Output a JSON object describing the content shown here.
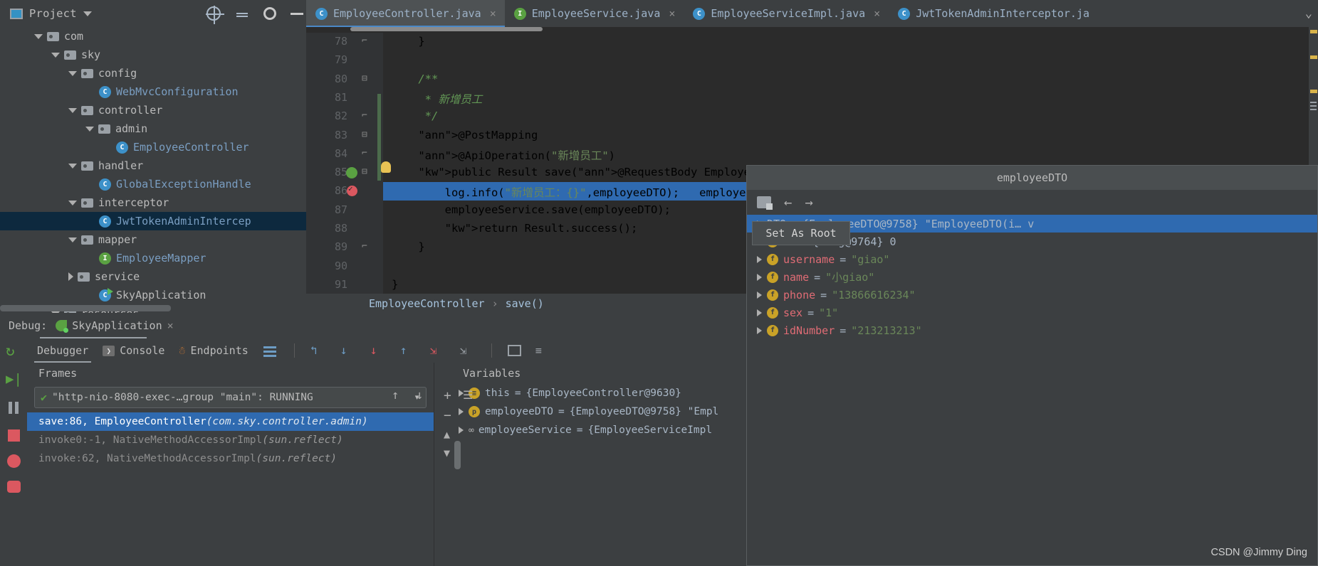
{
  "window": {
    "project_label": "Project",
    "icons": [
      "project-icon",
      "chevron-down-icon",
      "target-icon",
      "collapse-all-icon",
      "gear-icon",
      "minimize-icon"
    ]
  },
  "tabs": [
    {
      "label": "EmployeeController.java",
      "badge": "C",
      "badge_type": "class",
      "active": true,
      "close": "×"
    },
    {
      "label": "EmployeeService.java",
      "badge": "I",
      "badge_type": "interface",
      "active": false,
      "close": "×"
    },
    {
      "label": "EmployeeServiceImpl.java",
      "badge": "C",
      "badge_type": "class",
      "active": false,
      "close": "×"
    },
    {
      "label": "JwtTokenAdminInterceptor.ja",
      "badge": "C",
      "badge_type": "class",
      "active": false,
      "close": ""
    }
  ],
  "tabs_more_icon": "⌄",
  "tree": [
    {
      "label": "com",
      "indent": 2,
      "arrow": "down",
      "icon": "folder",
      "selected": false
    },
    {
      "label": "sky",
      "indent": 3,
      "arrow": "down",
      "icon": "folder",
      "selected": false
    },
    {
      "label": "config",
      "indent": 4,
      "arrow": "down",
      "icon": "folder",
      "selected": false
    },
    {
      "label": "WebMvcConfiguration",
      "indent": 5,
      "arrow": "none",
      "icon": "class",
      "selected": false
    },
    {
      "label": "controller",
      "indent": 4,
      "arrow": "down",
      "icon": "folder",
      "selected": false
    },
    {
      "label": "admin",
      "indent": 5,
      "arrow": "down",
      "icon": "folder",
      "selected": false
    },
    {
      "label": "EmployeeController",
      "indent": 6,
      "arrow": "none",
      "icon": "class",
      "selected": false
    },
    {
      "label": "handler",
      "indent": 4,
      "arrow": "down",
      "icon": "folder",
      "selected": false
    },
    {
      "label": "GlobalExceptionHandle",
      "indent": 5,
      "arrow": "none",
      "icon": "class",
      "selected": false
    },
    {
      "label": "interceptor",
      "indent": 4,
      "arrow": "down",
      "icon": "folder",
      "selected": false
    },
    {
      "label": "JwtTokenAdminIntercep",
      "indent": 5,
      "arrow": "none",
      "icon": "class",
      "selected": true
    },
    {
      "label": "mapper",
      "indent": 4,
      "arrow": "down",
      "icon": "folder",
      "selected": false
    },
    {
      "label": "EmployeeMapper",
      "indent": 5,
      "arrow": "none",
      "icon": "interface",
      "selected": false
    },
    {
      "label": "service",
      "indent": 4,
      "arrow": "right",
      "icon": "folder",
      "selected": false
    },
    {
      "label": "SkyApplication",
      "indent": 5,
      "arrow": "none",
      "icon": "spring-class",
      "selected": false
    },
    {
      "label": "resources",
      "indent": 3,
      "arrow": "down",
      "icon": "resources-folder",
      "selected": false
    }
  ],
  "editor": {
    "lines": [
      {
        "n": "78",
        "fold": "collapse",
        "text": "    }"
      },
      {
        "n": "79",
        "fold": "",
        "text": ""
      },
      {
        "n": "80",
        "fold": "expand",
        "text": "    /**"
      },
      {
        "n": "81",
        "fold": "",
        "text": "     * 新增员工"
      },
      {
        "n": "82",
        "fold": "collapse",
        "text": "     */"
      },
      {
        "n": "83",
        "fold": "expand",
        "text": "    @PostMapping"
      },
      {
        "n": "84",
        "fold": "collapse",
        "text": "    @ApiOperation(\"新增员工\")"
      },
      {
        "n": "85",
        "fold": "expand",
        "text": "    public Result save(@RequestBody EmployeeDTO emplo"
      },
      {
        "n": "86",
        "fold": "",
        "text": "        log.info(\"新增员工：{}\",employeeDTO);   employee"
      },
      {
        "n": "87",
        "fold": "",
        "text": "        employeeService.save(employeeDTO);"
      },
      {
        "n": "88",
        "fold": "",
        "text": "        return Result.success();"
      },
      {
        "n": "89",
        "fold": "collapse",
        "text": "    }"
      },
      {
        "n": "90",
        "fold": "",
        "text": ""
      },
      {
        "n": "91",
        "fold": "",
        "text": "}"
      }
    ],
    "highlighted_line": "86",
    "breadcrumb": [
      "EmployeeController",
      "save()"
    ],
    "breadcrumb_sep": "›"
  },
  "debug": {
    "label": "Debug:",
    "config_name": "SkyApplication",
    "close": "×",
    "tabs": [
      {
        "label": "Debugger",
        "active": true,
        "icon": ""
      },
      {
        "label": "Console",
        "active": false,
        "icon": "console-icon"
      },
      {
        "label": "Endpoints",
        "active": false,
        "icon": "endpoints-icon"
      }
    ],
    "toolbar_icons": [
      "layout-icon",
      "step-over-icon",
      "step-into-icon",
      "force-step-into-icon",
      "step-out-icon",
      "run-to-cursor-icon",
      "evaluate-icon",
      "table-icon",
      "settings-icon"
    ],
    "rail_icons": [
      "rerun-icon",
      "resume-icon",
      "pause-icon",
      "stop-icon",
      "mute-breakpoints-icon",
      "screenshot-icon"
    ],
    "frames": {
      "header": "Frames",
      "thread": "\"http-nio-8080-exec-…group \"main\": RUNNING",
      "thread_caret": "▾",
      "stack": [
        {
          "method": "save:86, EmployeeController",
          "pkg": "(com.sky.controller.admin)",
          "selected": true
        },
        {
          "method": "invoke0:-1, NativeMethodAccessorImpl",
          "pkg": "(sun.reflect)",
          "selected": false
        },
        {
          "method": "invoke:62, NativeMethodAccessorImpl",
          "pkg": "(sun.reflect)",
          "selected": false
        }
      ]
    },
    "variables": {
      "header": "Variables",
      "rows": [
        {
          "badge": "this",
          "badge_kind": "this",
          "name": "this",
          "eq": "=",
          "value": "{EmployeeController@9630}",
          "value_kind": "plain"
        },
        {
          "badge": "p",
          "badge_kind": "p",
          "name": "employeeDTO",
          "eq": "=",
          "value": "{EmployeeDTO@9758} \"Empl",
          "value_kind": "plain"
        },
        {
          "badge": "oo",
          "badge_kind": "oo",
          "name": "employeeService",
          "eq": "=",
          "value": "{EmployeeServiceImpl",
          "value_kind": "plain"
        }
      ],
      "side_buttons": [
        "add-icon",
        "remove-icon",
        "move-up-icon",
        "move-down-icon"
      ]
    }
  },
  "popup": {
    "title": "employeeDTO",
    "toolbar_icons": [
      "set-as-root-icon",
      "back-arrow-icon",
      "forward-arrow-icon"
    ],
    "tooltip": "Set As Root",
    "rows": [
      {
        "name": "DTO",
        "eq": "=",
        "value": "{EmployeeDTO@9758} \"EmployeeDTO(i… v",
        "selected": true,
        "badge": "",
        "partial": true
      },
      {
        "name": "id",
        "eq": "=",
        "value": "{Long@9764} 0",
        "selected": false,
        "badge": "f",
        "occluded": true
      },
      {
        "name": "username",
        "eq": "=",
        "value": "\"giao\"",
        "selected": false,
        "badge": "f"
      },
      {
        "name": "name",
        "eq": "=",
        "value": "\"小giao\"",
        "selected": false,
        "badge": "f"
      },
      {
        "name": "phone",
        "eq": "=",
        "value": "\"13866616234\"",
        "selected": false,
        "badge": "f"
      },
      {
        "name": "sex",
        "eq": "=",
        "value": "\"1\"",
        "selected": false,
        "badge": "f"
      },
      {
        "name": "idNumber",
        "eq": "=",
        "value": "\"213213213\"",
        "selected": false,
        "badge": "f"
      }
    ],
    "watermark": "CSDN @Jimmy Ding"
  },
  "colors": {
    "accent_blue": "#2f6ab0",
    "panel_bg": "#3c3f41",
    "editor_bg": "#2b2b2b",
    "keyword": "#cc7832",
    "string": "#6a8759",
    "annotation": "#bbb529",
    "comment": "#629755",
    "selection": "#0d293e"
  }
}
